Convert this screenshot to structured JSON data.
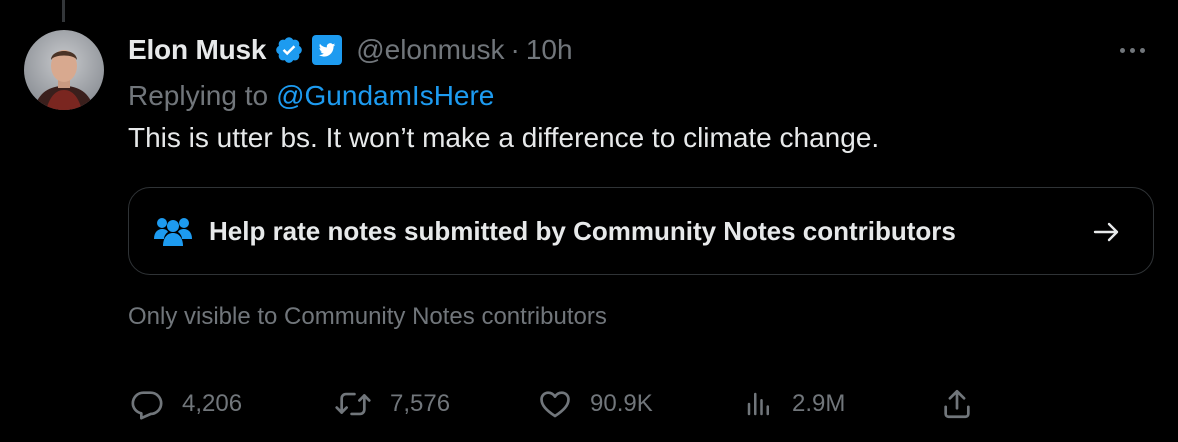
{
  "tweet": {
    "author_name": "Elon Musk",
    "handle": "@elonmusk",
    "separator": "·",
    "time": "10h",
    "replying_prefix": "Replying to",
    "replying_to": "@GundamIsHere",
    "text": "This is utter bs. It won’t make a difference to climate change."
  },
  "community_note": {
    "label": "Help rate notes submitted by Community Notes contributors",
    "visibility": "Only visible to Community Notes contributors"
  },
  "actions": {
    "replies": "4,206",
    "retweets": "7,576",
    "likes": "90.9K",
    "views": "2.9M"
  },
  "colors": {
    "background": "#000000",
    "text_primary": "#e7e9ea",
    "text_secondary": "#71767b",
    "accent": "#1d9bf0",
    "border": "#2f3336"
  },
  "icons": {
    "verified": "verified-badge-icon",
    "affiliate": "twitter-bird-badge-icon",
    "more": "more-dots-icon",
    "community": "people-icon",
    "arrow": "arrow-right-icon",
    "reply": "reply-bubble-icon",
    "retweet": "retweet-icon",
    "like": "heart-icon",
    "views": "bar-chart-icon",
    "share": "share-icon"
  }
}
